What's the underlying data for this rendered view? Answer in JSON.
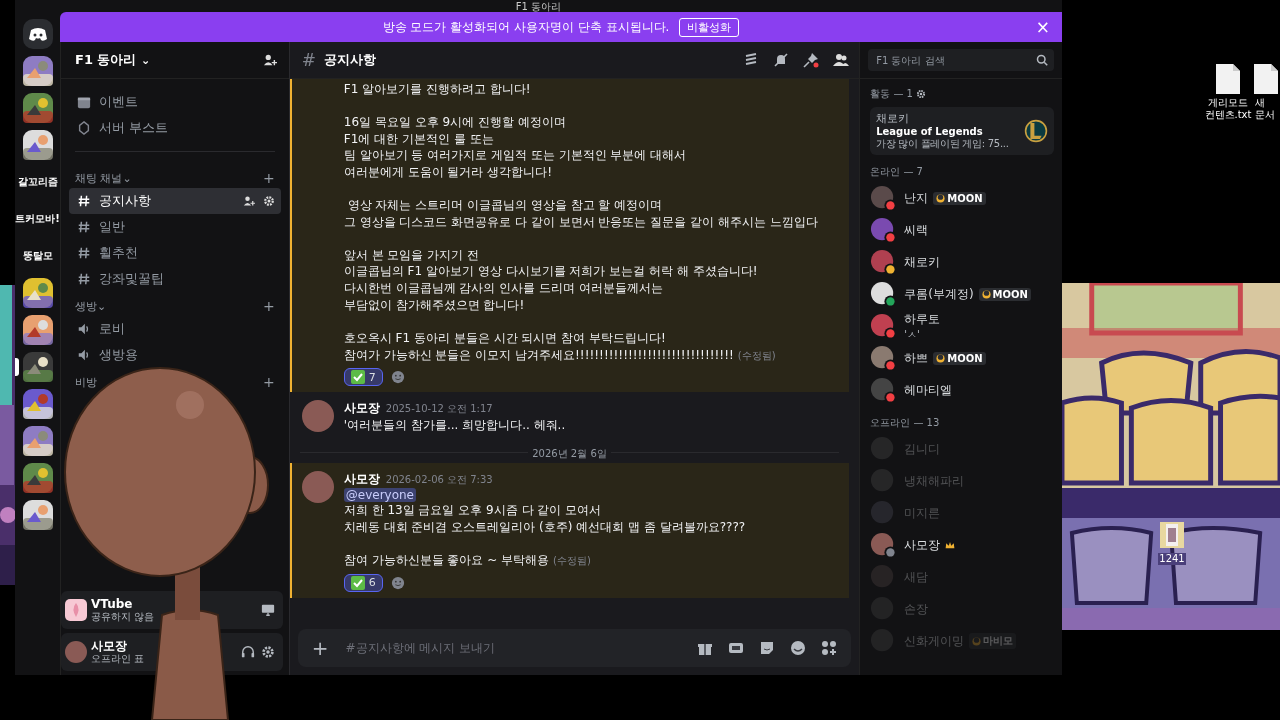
{
  "title_bar": {
    "title": "F1 동아리"
  },
  "banner": {
    "text": "방송 모드가 활성화되어 사용자명이 단축 표시됩니다.",
    "button": "비활성화",
    "close": "×"
  },
  "server_rail": [
    {
      "kind": "home",
      "selected": false
    },
    {
      "kind": "picture",
      "selected": false
    },
    {
      "kind": "picture",
      "selected": false
    },
    {
      "kind": "picture",
      "selected": false
    },
    {
      "kind": "text",
      "label": "갈꼬리즘",
      "selected": false
    },
    {
      "kind": "text",
      "label": "트커모바!",
      "selected": false
    },
    {
      "kind": "text",
      "label": "뚱탈모",
      "selected": false
    },
    {
      "kind": "picture",
      "selected": false
    },
    {
      "kind": "picture",
      "selected": false
    },
    {
      "kind": "picture",
      "selected": true
    },
    {
      "kind": "picture",
      "selected": false
    },
    {
      "kind": "picture",
      "selected": false
    },
    {
      "kind": "picture",
      "selected": false
    },
    {
      "kind": "picture",
      "selected": false
    }
  ],
  "server": {
    "name": "F1 동아리",
    "caret": "⌄"
  },
  "sidebar_links": [
    {
      "kind": "events",
      "label": "이벤트"
    },
    {
      "kind": "boost",
      "label": "서버 부스트"
    }
  ],
  "categories": [
    {
      "name": "채팅 채널",
      "caret": "⌄",
      "plus": "+",
      "channels": [
        {
          "kind": "text",
          "name": "공지사항",
          "selected": true
        },
        {
          "kind": "text",
          "name": "일반",
          "selected": false
        },
        {
          "kind": "text",
          "name": "휠추천",
          "selected": false
        },
        {
          "kind": "text",
          "name": "강좌및꿀팁",
          "selected": false
        }
      ]
    },
    {
      "name": "생방",
      "caret": "⌄",
      "plus": "+",
      "channels": [
        {
          "kind": "voice",
          "name": "로비",
          "selected": false
        },
        {
          "kind": "voice",
          "name": "생방용",
          "selected": false
        }
      ]
    },
    {
      "name": "비방",
      "plus": "+"
    }
  ],
  "stream_panel": {
    "title": "VTube",
    "subtitle": "공유하지 않음"
  },
  "user_panel": {
    "name": "사모장",
    "status": "오프라인 표"
  },
  "channel_header": {
    "hash": "#",
    "name": "공지사항"
  },
  "messages": [
    {
      "kind": "continuation",
      "highlighted": true,
      "paragraphs": [
        [
          "F1 알아보기를 진행하려고 합니다!"
        ],
        [
          "16일 목요일 오후 9시에 진행할 예정이며",
          "F1에 대한 기본적인 룰 또는",
          "팀 알아보기 등 여러가지로 게임적 또는 기본적인 부분에 대해서",
          "여러분에게 도움이 될거라 생각합니다!"
        ],
        [
          " 영상 자체는 스트리머 이글콥님의 영상을 참고 할 예정이며",
          "그 영상을 디스코드 화면공유로 다 같이 보면서 반응또는 질문을 같이 해주시는 느낌입다"
        ],
        [
          "앞서 본 모임을 가지기 전",
          "이글콥님의 F1 알아보기 영상 다시보기를 저희가 보는걸 허락 해 주셨습니다!",
          "다시한번 이글콥님께 감사의 인사를 드리며 여러분들께서는",
          "부담없이 참가해주셨으면 합니다!"
        ],
        [
          "호오옥시 F1 동아리 분들은 시간 되시면 참여 부탁드립니다!",
          "참여가 가능하신 분들은 이모지 남겨주세요!!!!!!!!!!!!!!!!!!!!!!!!!!!!!!!!!"
        ]
      ],
      "edited": "(수정됨)",
      "reactions": [
        {
          "count": "7",
          "selected": true
        }
      ]
    },
    {
      "kind": "full",
      "highlighted": false,
      "author": "사모장",
      "time": "2025-10-12 오전 1:17",
      "paragraphs": [
        [
          "'여러분들의 참가를... 희망합니다.. 헤줘.."
        ]
      ]
    },
    {
      "kind": "divider",
      "label": "2026년 2월 6일"
    },
    {
      "kind": "full",
      "highlighted": true,
      "author": "사모장",
      "time": "2026-02-06 오전 7:33",
      "mention": "@everyone",
      "paragraphs": [
        [
          "저희 한 13일 금요일 오후 9시즘 다 같이 모여서",
          "치레동 대회 준비겸 오스트레일리아 (호주) 예선대회 맵 좀 달려볼까요????"
        ],
        [
          "참여 가능하신분들 좋아요 ~ 부탁해용"
        ]
      ],
      "edited": "(수정됨)",
      "reactions": [
        {
          "count": "6",
          "selected": true
        }
      ]
    }
  ],
  "composer": {
    "plus": "+",
    "placeholder": "#공지사항에 메시지 보내기"
  },
  "member_list": {
    "search_placeholder": "F1 동아리 검색",
    "activity_title": "활동 — 1",
    "activity": {
      "user": "채로키",
      "game": "League of Legends",
      "detail": "가장 많이 플레이된 게임: 75..."
    },
    "groups": [
      {
        "title": "온라인 — 7",
        "members": [
          {
            "name": "난지",
            "color": "#f23f43",
            "badge": "MOON",
            "dimmed": false,
            "owner": false
          },
          {
            "name": "씨랙",
            "color": "#f23f43",
            "dimmed": false,
            "owner": false
          },
          {
            "name": "채로키",
            "color": "#f0b232",
            "dimmed": false,
            "owner": false
          },
          {
            "name": "쿠롬(부계정)",
            "color": "#23a55a",
            "badge": "MOON",
            "dimmed": false,
            "owner": false
          },
          {
            "name": "하루토",
            "subtitle": "'ㅅ'",
            "color": "#f23f43",
            "dimmed": false,
            "owner": false
          },
          {
            "name": "하쁘",
            "color": "#f23f43",
            "badge": "MOON",
            "dimmed": false,
            "owner": false
          },
          {
            "name": "헤마티엘",
            "color": "#f23f43",
            "dimmed": false,
            "owner": false
          }
        ]
      },
      {
        "title": "오프라인 — 13",
        "members": [
          {
            "name": "김니디",
            "dimmed": true,
            "owner": false
          },
          {
            "name": "냉채해파리",
            "dimmed": true,
            "owner": false
          },
          {
            "name": "미지른",
            "dimmed": true,
            "owner": false
          },
          {
            "name": "사모장",
            "color": "#80848e",
            "dimmed": false,
            "owner": true
          },
          {
            "name": "새담",
            "dimmed": true,
            "owner": false
          },
          {
            "name": "손장",
            "dimmed": true,
            "owner": false
          },
          {
            "name": "신화게이밍",
            "badge": "마비모",
            "dimmed": true,
            "owner": false
          }
        ]
      }
    ]
  },
  "desktop_icons": [
    {
      "kind": "file",
      "lines": [
        "게리모드",
        "컨텐츠.txt"
      ]
    },
    {
      "kind": "file",
      "lines": [
        "새",
        "문서"
      ]
    },
    {
      "kind": "folder",
      "lines": [
        "1241"
      ]
    }
  ]
}
